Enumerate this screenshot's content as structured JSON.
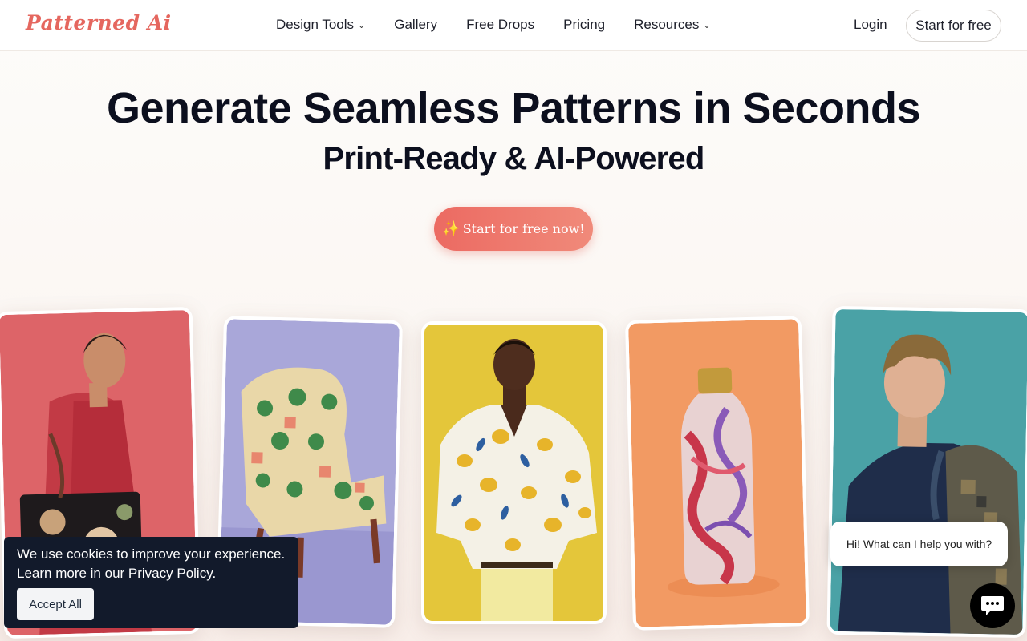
{
  "brand": {
    "logo_text": "Patterned Ai",
    "accent": "#e5675f"
  },
  "nav": {
    "items": [
      {
        "label": "Design Tools",
        "has_dropdown": true
      },
      {
        "label": "Gallery",
        "has_dropdown": false
      },
      {
        "label": "Free Drops",
        "has_dropdown": false
      },
      {
        "label": "Pricing",
        "has_dropdown": false
      },
      {
        "label": "Resources",
        "has_dropdown": true
      }
    ],
    "login_label": "Login",
    "start_label": "Start for free"
  },
  "hero": {
    "title": "Generate Seamless Patterns in Seconds",
    "subtitle": "Print-Ready & AI-Powered",
    "cta_label": "Start for free now!",
    "cta_icon": "sparkle-icon"
  },
  "cards": [
    {
      "subject": "woman-with-floral-tote",
      "background": "#e0676a"
    },
    {
      "subject": "palm-pattern-armchair",
      "background": "#a9a7d9"
    },
    {
      "subject": "man-in-lemon-shirt",
      "background": "#e4c63a"
    },
    {
      "subject": "marbled-water-bottle",
      "background": "#f29a63"
    },
    {
      "subject": "teen-with-patterned-backpack",
      "background": "#4aa2a6"
    }
  ],
  "cookie": {
    "line1": "We use cookies to improve your experience.",
    "line2_prefix": "Learn more in our ",
    "link_label": "Privacy Policy",
    "line2_suffix": ".",
    "accept_label": "Accept All"
  },
  "chat": {
    "greeting": "Hi! What can I help you with?",
    "icon": "chat-icon"
  }
}
